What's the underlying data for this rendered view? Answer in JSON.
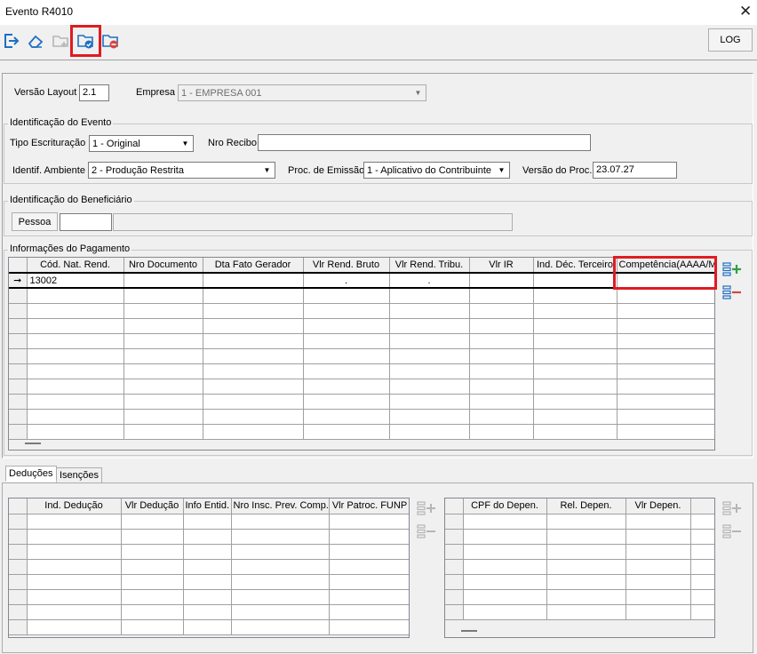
{
  "window": {
    "title": "Evento R4010",
    "close_glyph": "✕"
  },
  "toolbar": {
    "buttons": [
      {
        "name": "exit-icon"
      },
      {
        "name": "eraser-icon"
      },
      {
        "name": "add-folder-icon"
      },
      {
        "name": "folder-check-icon"
      },
      {
        "name": "folder-cancel-icon"
      }
    ],
    "log_label": "LOG"
  },
  "header": {
    "versao_layout_label": "Versão Layout",
    "versao_layout_value": "2.1",
    "empresa_label": "Empresa",
    "empresa_value": "1 - EMPRESA 001"
  },
  "identificacao_evento": {
    "title": "Identificação do Evento",
    "tipo_escrituracao_label": "Tipo Escrituração",
    "tipo_escrituracao_value": "1 - Original",
    "nro_recibo_label": "Nro Recibo",
    "nro_recibo_value": "",
    "ambiente_label": "Identif. Ambiente",
    "ambiente_value": "2 - Produção Restrita",
    "proc_emissao_label": "Proc. de Emissão",
    "proc_emissao_value": "1 - Aplicativo do Contribuinte",
    "versao_proc_label": "Versão do Proc.",
    "versao_proc_value": "23.07.27"
  },
  "identificacao_beneficiario": {
    "title": "Identificação do Beneficiário",
    "pessoa_label": "Pessoa",
    "pessoa_code": "",
    "pessoa_name": ""
  },
  "pagamento": {
    "title": "Informações do Pagamento",
    "columns": [
      "Cód. Nat. Rend.",
      "Nro Documento",
      "Dta Fato Gerador",
      "Vlr Rend. Bruto",
      "Vlr Rend. Tribu.",
      "Vlr IR",
      "Ind. Déc. Terceiro",
      "Competência(AAAA/M"
    ],
    "rows": [
      {
        "indicator": "➞",
        "cells": [
          "13002",
          "",
          "",
          ".",
          ".",
          "",
          "",
          ""
        ]
      }
    ],
    "empty_rows": 10
  },
  "tabs": [
    "Deduções",
    "Isenções"
  ],
  "deducoes": {
    "columns": [
      "Ind. Dedução",
      "Vlr Dedução",
      "Info Entid.",
      "Nro Insc. Prev. Comp.",
      "Vlr Patroc. FUNP"
    ],
    "empty_rows": 8
  },
  "dependentes": {
    "columns": [
      "CPF do Depen.",
      "Rel. Depen.",
      "Vlr Depen."
    ],
    "empty_rows": 7
  },
  "colors": {
    "highlight": "#e01b22",
    "accent": "#1e6fc2",
    "add": "#2ea043",
    "remove": "#d64541"
  }
}
